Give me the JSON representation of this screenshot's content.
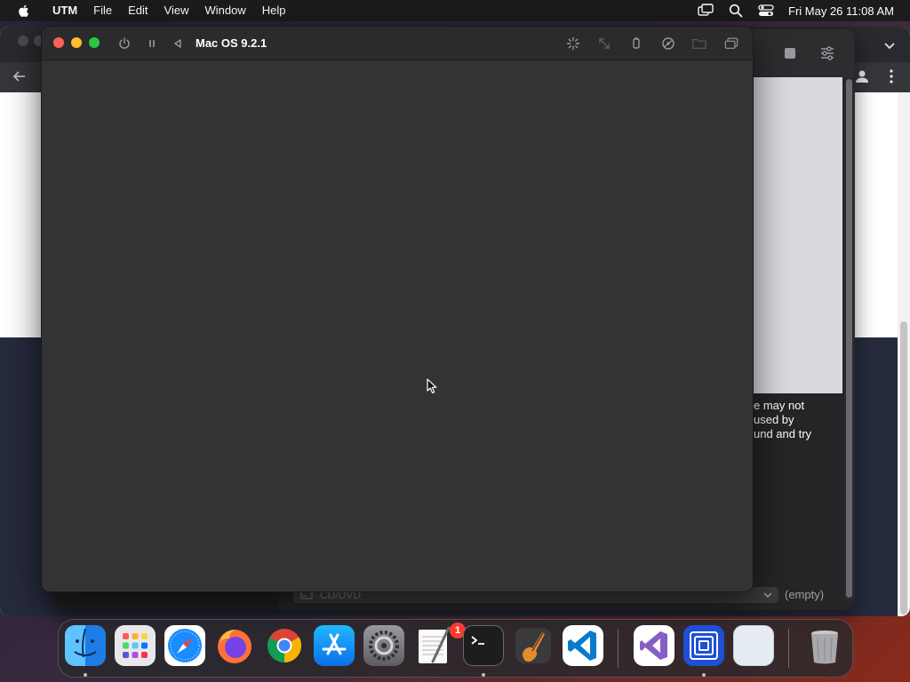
{
  "menubar": {
    "app_name": "UTM",
    "items": [
      "File",
      "Edit",
      "View",
      "Window",
      "Help"
    ],
    "clock": "Fri May 26  11:08 AM",
    "status_icons": [
      "screen-mirroring-icon",
      "spotlight-search-icon",
      "control-center-icon"
    ]
  },
  "vm_window": {
    "title": "Mac OS 9.2.1",
    "toolbar_icons": [
      "power-icon",
      "pause-icon",
      "restart-icon",
      "capture-input-icon",
      "resize-icon",
      "usb-icon",
      "drive-icon",
      "shared-folder-icon",
      "windows-icon"
    ]
  },
  "library": {
    "message": "e may not\nused by\nund and try",
    "drive_label": "CD/DVD",
    "drive_value": "(empty)"
  },
  "dock": {
    "apps": [
      "Finder",
      "Launchpad",
      "Safari",
      "Firefox",
      "Google Chrome",
      "App Store",
      "System Settings",
      "TextEdit",
      "Terminal",
      "GarageBand",
      "Visual Studio Code",
      "Visual Studio",
      "UTM",
      "Preview"
    ],
    "trash": "Trash",
    "settings_badge": "1"
  },
  "colors": {
    "close": "#ff5f57",
    "minimize": "#febc2e",
    "zoom": "#28c840",
    "vm_display": "#333333",
    "badge": "#ff3b30"
  }
}
